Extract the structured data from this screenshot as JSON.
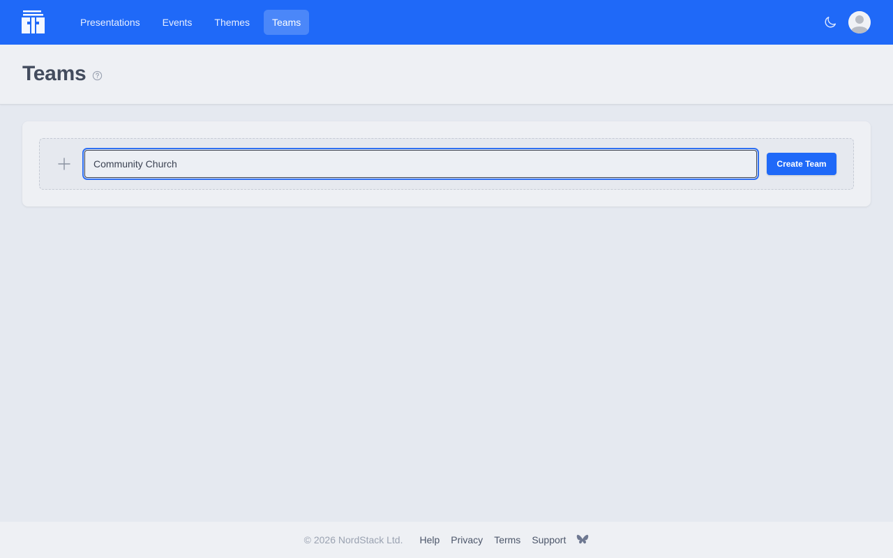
{
  "nav": {
    "items": [
      {
        "label": "Presentations",
        "active": false
      },
      {
        "label": "Events",
        "active": false
      },
      {
        "label": "Themes",
        "active": false
      },
      {
        "label": "Teams",
        "active": true
      }
    ]
  },
  "icons": {
    "logo": "cross-logo-icon",
    "theme_toggle": "moon-icon",
    "avatar": "user-avatar-icon",
    "help": "question-circle-icon",
    "add": "plus-icon",
    "social": "butterfly-icon"
  },
  "page": {
    "title": "Teams"
  },
  "create_team": {
    "input_value": "Community Church",
    "button_label": "Create Team"
  },
  "footer": {
    "copyright": "© 2026 NordStack Ltd.",
    "links": [
      "Help",
      "Privacy",
      "Terms",
      "Support"
    ]
  },
  "colors": {
    "brand": "#1f69f8",
    "background": "#e5e9f0",
    "surface": "#eef0f4",
    "text": "#434c5e"
  }
}
